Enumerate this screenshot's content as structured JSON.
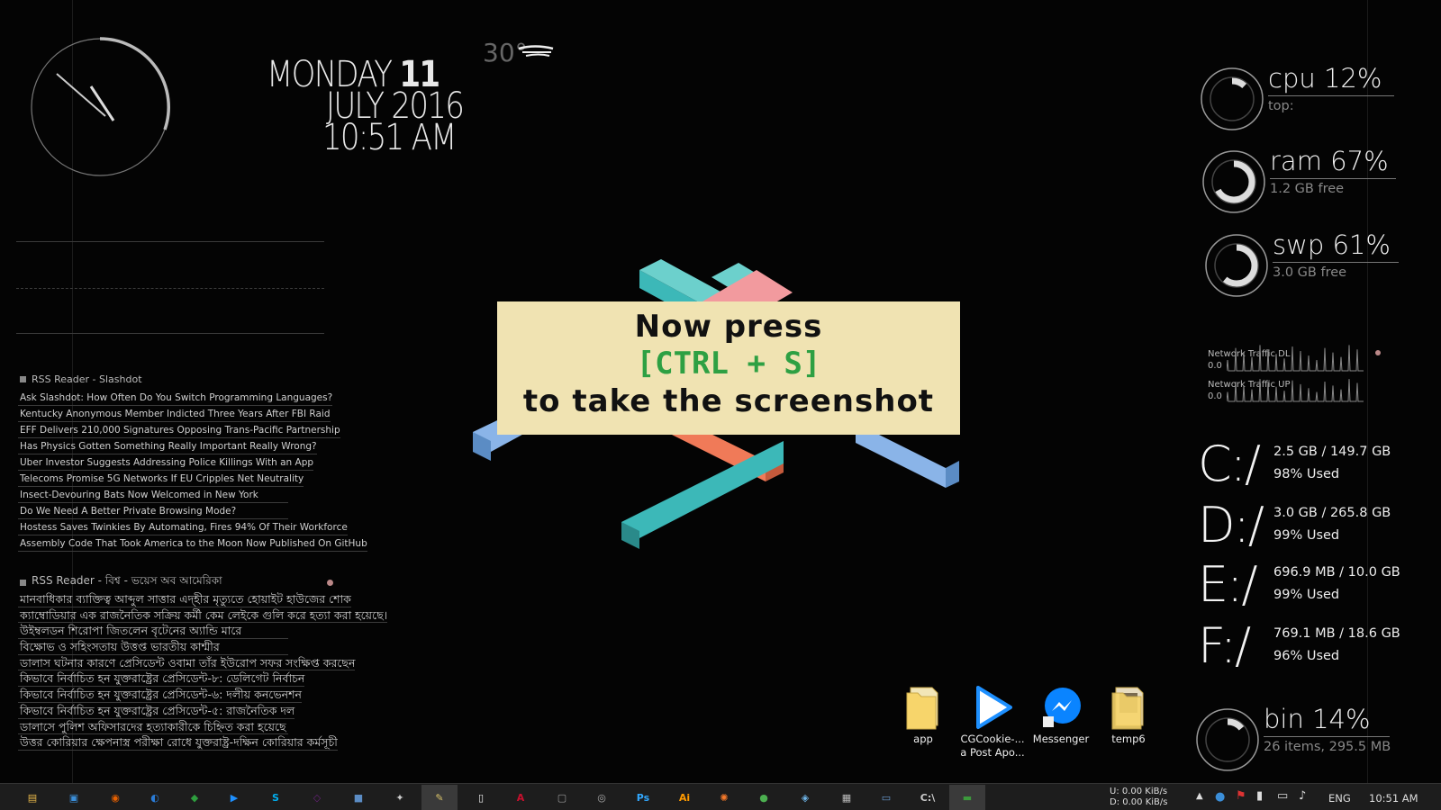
{
  "clock_widget": {
    "label": "analog clock"
  },
  "datetime": {
    "weekday": "MONDAY",
    "day": "11",
    "month_year": "JULY 2016",
    "time": "10:51 AM"
  },
  "weather": {
    "temp": "30°"
  },
  "rss_slashdot": {
    "title": "RSS Reader - Slashdot",
    "items": [
      "Ask Slashdot:  How Often Do You Switch Programming Languages?",
      "Kentucky Anonymous Member Indicted Three Years After FBI Raid",
      "EFF Delivers 210,000 Signatures Opposing Trans-Pacific Partnership",
      "Has Physics Gotten Something Really Important Really Wrong?",
      "Uber Investor Suggests Addressing Police Killings With an App",
      "Telecoms Promise 5G Networks If EU Cripples Net Neutrality",
      "Insect-Devouring Bats Now Welcomed in New York",
      "Do We  Need A Better Private Browsing Mode?",
      "Hostess Saves Twinkies By Automating, Fires 94% Of Their Workforce",
      "Assembly Code That Took America to the Moon Now Published On GitHub"
    ]
  },
  "rss_voa": {
    "title": "RSS Reader - বিশ্ব - ভয়েস অব আমেরিকা",
    "items": [
      "মানবাধিকার ব্যাক্তিত্ব আব্দুল সাত্তার এদ্হীর মৃত্যুতে হোয়াইট হাউজের শোক",
      "ক্যাম্বোডিয়ার এক রাজনৈতিক সক্রিয় কর্মী কেম লেইকে গুলি করে হত্যা করা হয়েছে।",
      "উইম্বলডন শিরোপা জিতলেন বৃটেনের অ্যান্ডি মারে",
      "বিক্ষোভ ও সহিংসতায় উত্তপ্ত ভারতীয় কাশ্মীর",
      "ডালাস ঘটনার কারণে প্রেসিডেন্ট ওবামা তাঁর ইউরোপ সফর সংক্ষিপ্ত করছেন",
      "কিভাবে নির্বাচিত হন যুক্তরাষ্ট্রের প্রেসিডেন্ট-৮: ডেলিগেট নির্বাচন",
      "কিভাবে নির্বাচিত হন যুক্তরাষ্ট্রের প্রেসিডেন্ট-৬: দলীয় কনভেনশন",
      "কিভাবে নির্বাচিত হন যুক্তরাষ্ট্রের প্রেসিডেন্ট-৫: রাজনৈতিক দল",
      "ডালাসে পুলিশ অফিসারদের হত্যাকারীকে চিহ্নিত করা হয়েছে",
      "উত্তর কোরিয়ার ক্ষেপনাস্ত্র পরীক্ষা রোধে যুক্তরাষ্ট্র-দক্ষিন কোরিয়ার কর্মসূচী"
    ]
  },
  "popup": {
    "line1": "Now press",
    "line2": "[CTRL + S]",
    "line3": "to take the screenshot",
    "bg": "#f0e3b2",
    "accent": "#2ea043"
  },
  "gauges": {
    "cpu": {
      "title": "cpu 12%",
      "sub": "top:",
      "level": 0.12
    },
    "ram": {
      "title": "ram 67%",
      "sub": "1.2 GB free",
      "level": 0.67
    },
    "swp": {
      "title": "swp 61%",
      "sub": "3.0 GB free",
      "level": 0.61
    },
    "bin": {
      "title": "bin 14%",
      "sub": "26 items, 295.5 MB",
      "level": 0.14
    }
  },
  "network": {
    "dl_label": "Network Traffic DL",
    "dl_value": "0.0",
    "up_label": "Network Traffic UP",
    "up_value": "0.0"
  },
  "drives": [
    {
      "letter": "C:/",
      "size": "2.5 GB /   149.7 GB",
      "used": "98% Used"
    },
    {
      "letter": "D:/",
      "size": "3.0 GB /   265.8 GB",
      "used": "99% Used"
    },
    {
      "letter": "E:/",
      "size": "696.9 MB /  10.0 GB",
      "used": "99% Used"
    },
    {
      "letter": "F:/",
      "size": "769.1 MB / 18.6 GB",
      "used": "96% Used"
    }
  ],
  "desktop_icons": [
    {
      "label": "app",
      "icon": "folder-icon"
    },
    {
      "label": "CGCookie-...\na Post Apo...",
      "icon": "play-icon"
    },
    {
      "label": "Messenger",
      "icon": "messenger-icon"
    },
    {
      "label": "temp6",
      "icon": "folder-icon"
    }
  ],
  "taskbar": {
    "apps": [
      {
        "name": "file-explorer",
        "glyph": "▤",
        "color": "#e8b84a"
      },
      {
        "name": "this-pc",
        "glyph": "▣",
        "color": "#3b8ed8"
      },
      {
        "name": "firefox",
        "glyph": "◉",
        "color": "#e66000"
      },
      {
        "name": "app-blue-circle",
        "glyph": "◐",
        "color": "#2a7bd6"
      },
      {
        "name": "green-app",
        "glyph": "◆",
        "color": "#2e9e3e"
      },
      {
        "name": "media-player",
        "glyph": "▶",
        "color": "#1e90ff"
      },
      {
        "name": "skype",
        "glyph": "S",
        "color": "#00aff0"
      },
      {
        "name": "visual-studio",
        "glyph": "◇",
        "color": "#68217a"
      },
      {
        "name": "cube-app",
        "glyph": "■",
        "color": "#5b8cc4"
      },
      {
        "name": "bird-app",
        "glyph": "✦",
        "color": "#ccc"
      },
      {
        "name": "notepad",
        "glyph": "✎",
        "color": "#d9c36a"
      },
      {
        "name": "document",
        "glyph": "▯",
        "color": "#eee"
      },
      {
        "name": "acrobat",
        "glyph": "A",
        "color": "#c8102e"
      },
      {
        "name": "window-app",
        "glyph": "▢",
        "color": "#999"
      },
      {
        "name": "eye-app",
        "glyph": "◎",
        "color": "#aaa"
      },
      {
        "name": "photoshop",
        "glyph": "Ps",
        "color": "#31a8ff"
      },
      {
        "name": "illustrator",
        "glyph": "Ai",
        "color": "#ff9a00"
      },
      {
        "name": "blender",
        "glyph": "✺",
        "color": "#f5792a"
      },
      {
        "name": "chrome",
        "glyph": "●",
        "color": "#4caf50"
      },
      {
        "name": "paint",
        "glyph": "◈",
        "color": "#6fb5e8"
      },
      {
        "name": "calculator",
        "glyph": "▦",
        "color": "#bbb"
      },
      {
        "name": "remote-desktop",
        "glyph": "▭",
        "color": "#6a9bd1"
      },
      {
        "name": "terminal",
        "glyph": "C:\\",
        "color": "#ccc"
      },
      {
        "name": "active-window",
        "glyph": "▬",
        "color": "#3c9a3c"
      }
    ],
    "net_up": "U:   0.00 KiB/s",
    "net_down": "D:   0.00 KiB/s",
    "language": "ENG",
    "time": "10:51 AM"
  }
}
